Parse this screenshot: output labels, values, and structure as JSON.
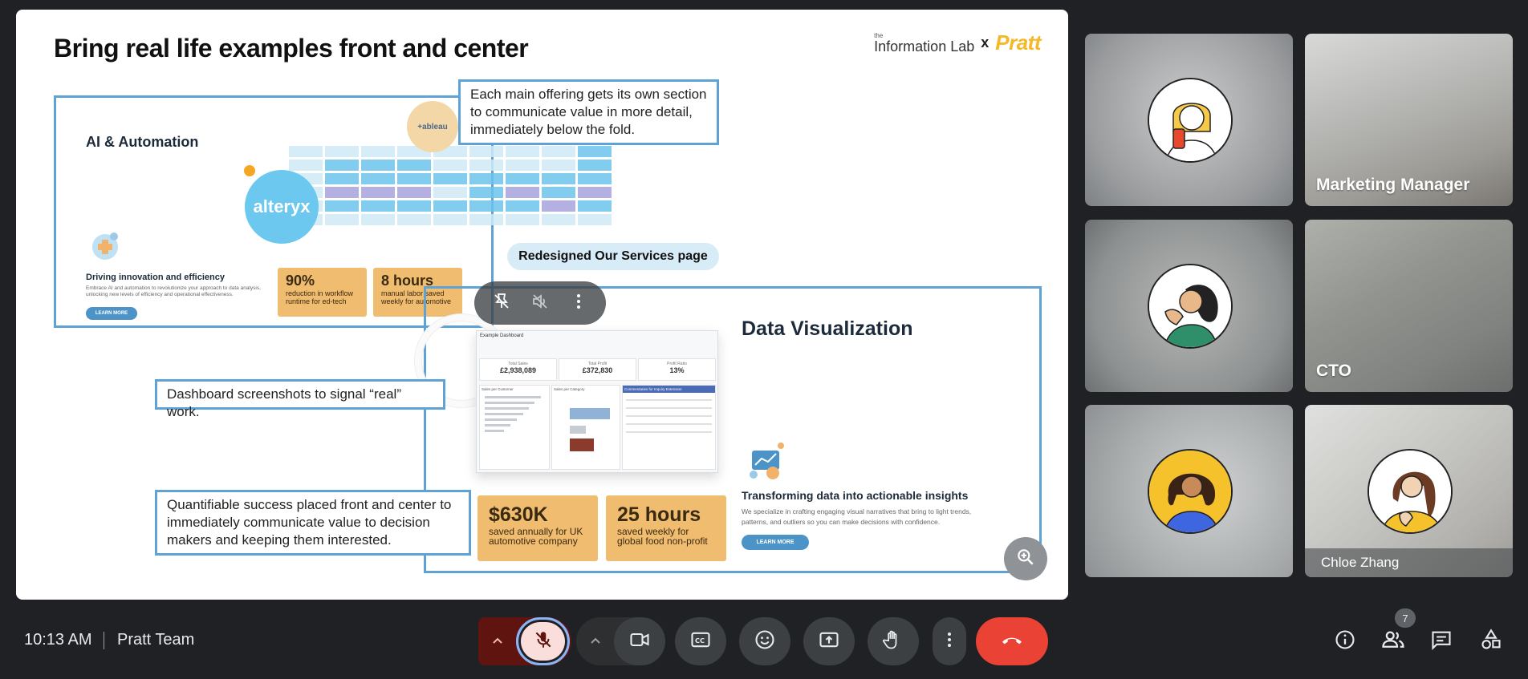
{
  "slide": {
    "title": "Bring real life examples front and center",
    "brand_small": "the",
    "brand_il": "Information Lab",
    "brand_x": "x",
    "brand_pratt": "Pratt",
    "callout_offering": "Each main offering gets its own section to communicate value in more detail, immediately below the fold.",
    "callout_redesigned": "Redesigned Our Services page",
    "callout_dashboard": "Dashboard screenshots to signal “real” work.",
    "callout_quantifiable": "Quantifiable success placed front and center to immediately communicate value to decision makers and keeping them interested.",
    "ai": {
      "heading": "AI & Automation",
      "tableau_logo": "+ableau",
      "alteryx_logo": "alteryx",
      "subheading": "Driving innovation and efficiency",
      "body": "Embrace AI and automation to revolutionize your approach to data analysis, unlocking new levels of efficiency and operational effectiveness.",
      "learn_more": "LEARN MORE",
      "stat1_value": "90%",
      "stat1_label": "reduction in workflow runtime for ed-tech",
      "stat2_value": "8 hours",
      "stat2_label": "manual labor saved weekly for automotive"
    },
    "dv": {
      "heading": "Data Visualization",
      "subheading": "Transforming data into actionable insights",
      "body": "We specialize in crafting engaging visual narratives that bring to light trends, patterns, and outliers so you can make decisions with confidence.",
      "learn_more": "LEARN MORE",
      "stat1_value": "$630K",
      "stat1_label": "saved annually for UK automotive company",
      "stat2_value": "25 hours",
      "stat2_label": "saved weekly for global food non-profit"
    },
    "dashboard": {
      "title": "Example Dashboard",
      "kpi1_label": "Total Sales",
      "kpi1_value": "£2,938,089",
      "kpi2_label": "Total Profit",
      "kpi2_value": "£372,830",
      "kpi3_label": "Profit Ratio",
      "kpi3_value": "13%",
      "panel1": "Sales per Customer",
      "panel2": "Sales per Category",
      "panel3": "Commentaries for Inquiry Extension"
    }
  },
  "participants": [
    {
      "name": "",
      "avatar": "blonde-woman-phone"
    },
    {
      "name": "Marketing Manager",
      "avatar": ""
    },
    {
      "name": "",
      "avatar": "curly-hair-woman"
    },
    {
      "name": "CTO",
      "avatar": ""
    },
    {
      "name": "",
      "avatar": "curly-hair-woman-blue"
    },
    {
      "name": "Chloe Zhang",
      "avatar": "long-hair-woman-yellow"
    }
  ],
  "bottom_bar": {
    "time": "10:13 AM",
    "meeting_name": "Pratt Team",
    "people_count": "7"
  },
  "colors": {
    "end_call": "#ea4335",
    "mic_off_bg": "#f9dedc",
    "accent_blue": "#5fa2d6",
    "stat_orange": "#f0bc70"
  }
}
